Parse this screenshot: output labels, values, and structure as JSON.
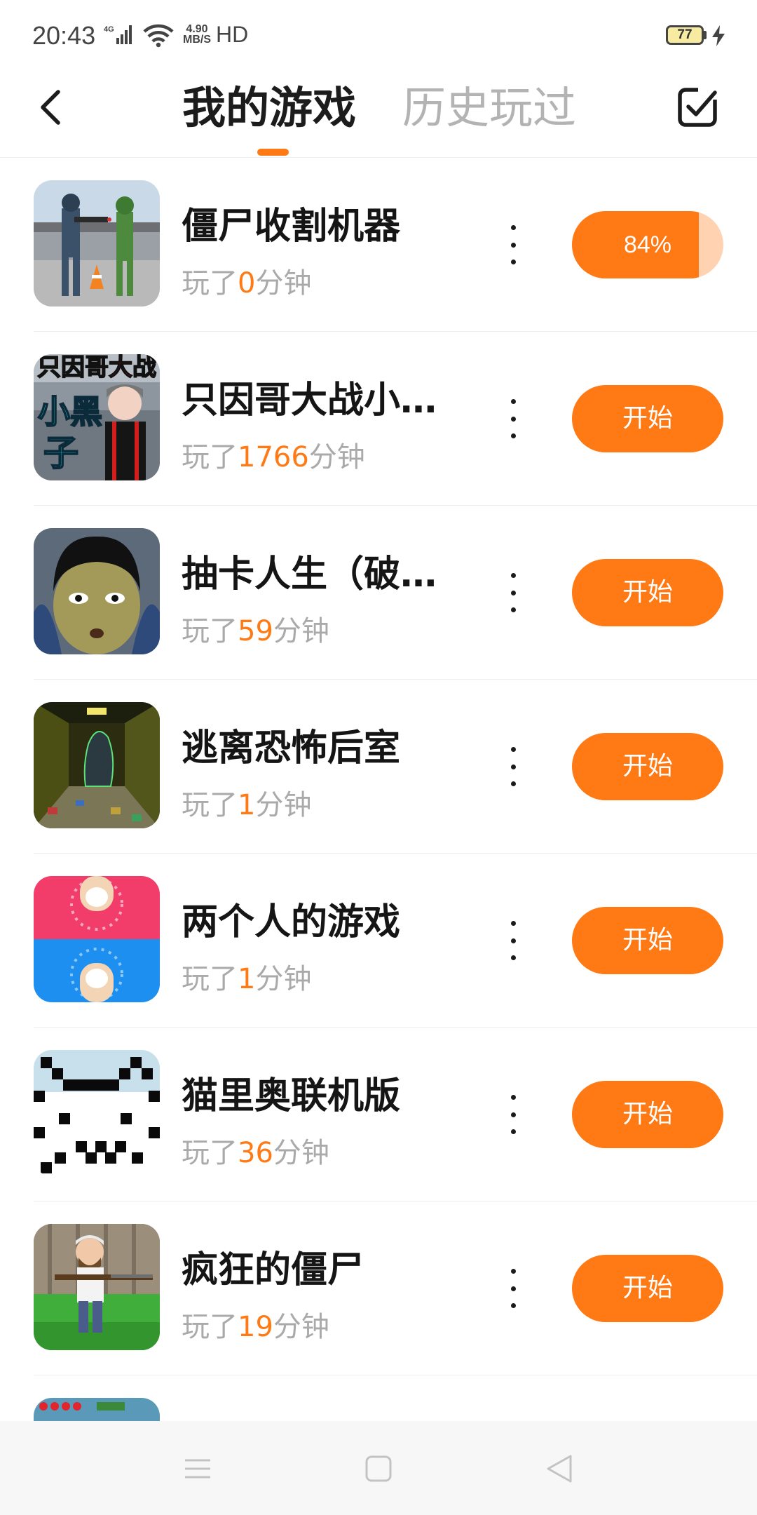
{
  "status_bar": {
    "time": "20:43",
    "network": "4G",
    "speed_value": "4.90",
    "speed_unit": "MB/S",
    "hd": "HD",
    "battery": "77"
  },
  "header": {
    "tab_my_games": "我的游戏",
    "tab_history": "历史玩过",
    "active_tab": "我的游戏",
    "accent_color": "#ff7a14"
  },
  "games": [
    {
      "title": "僵尸收割机器",
      "played_prefix": "玩了",
      "minutes": "0",
      "played_suffix": "分钟",
      "action": "84%",
      "progress": 0.84,
      "icon": "soldiers-icon"
    },
    {
      "title": "只因哥大战小…",
      "played_prefix": "玩了",
      "minutes": "1766",
      "played_suffix": "分钟",
      "action": "开始",
      "icon": "xiaoheizi-icon",
      "icon_text_top": "只因哥大战",
      "icon_text_left": "小黑",
      "icon_text_bottom": "子"
    },
    {
      "title": "抽卡人生（破…",
      "played_prefix": "玩了",
      "minutes": "59",
      "played_suffix": "分钟",
      "action": "开始",
      "icon": "face-icon"
    },
    {
      "title": "逃离恐怖后室",
      "played_prefix": "玩了",
      "minutes": "1",
      "played_suffix": "分钟",
      "action": "开始",
      "icon": "backrooms-icon"
    },
    {
      "title": "两个人的游戏",
      "played_prefix": "玩了",
      "minutes": "1",
      "played_suffix": "分钟",
      "action": "开始",
      "icon": "two-fingers-icon"
    },
    {
      "title": "猫里奥联机版",
      "played_prefix": "玩了",
      "minutes": "36",
      "played_suffix": "分钟",
      "action": "开始",
      "icon": "pixel-cat-icon"
    },
    {
      "title": "疯狂的僵尸",
      "played_prefix": "玩了",
      "minutes": "19",
      "played_suffix": "分钟",
      "action": "开始",
      "icon": "crazy-dave-icon"
    }
  ],
  "navbar": {
    "items": [
      "menu-icon",
      "home-square-icon",
      "back-triangle-icon"
    ]
  }
}
